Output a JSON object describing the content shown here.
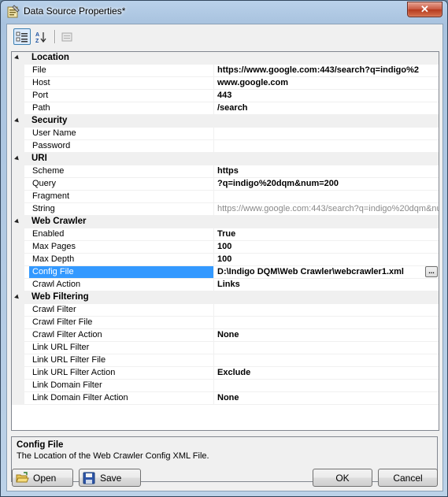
{
  "window": {
    "title": "Data Source Properties*",
    "close_glyph": "✕"
  },
  "toolbar": {
    "categorized_icon": "categorized-icon",
    "alphabetical_icon": "alphabetical-icon",
    "property_pages_icon": "property-pages-icon"
  },
  "grid": {
    "categories": [
      {
        "label": "Location",
        "props": [
          {
            "name": "File",
            "value": "https://www.google.com:443/search?q=indigo%2"
          },
          {
            "name": "Host",
            "value": "www.google.com"
          },
          {
            "name": "Port",
            "value": "443"
          },
          {
            "name": "Path",
            "value": "/search"
          }
        ]
      },
      {
        "label": "Security",
        "props": [
          {
            "name": "User Name",
            "value": ""
          },
          {
            "name": "Password",
            "value": ""
          }
        ]
      },
      {
        "label": "URI",
        "props": [
          {
            "name": "Scheme",
            "value": "https"
          },
          {
            "name": "Query",
            "value": "?q=indigo%20dqm&num=200"
          },
          {
            "name": "Fragment",
            "value": ""
          },
          {
            "name": "String",
            "value": "https://www.google.com:443/search?q=indigo%20dqm&nu"
          }
        ]
      },
      {
        "label": "Web Crawler",
        "props": [
          {
            "name": "Enabled",
            "value": "True"
          },
          {
            "name": "Max Pages",
            "value": "100"
          },
          {
            "name": "Max Depth",
            "value": "100"
          },
          {
            "name": "Config File",
            "value": "D:\\Indigo DQM\\Web Crawler\\webcrawler1.xml",
            "ellipsis": "..."
          },
          {
            "name": "Crawl Action",
            "value": "Links"
          }
        ]
      },
      {
        "label": "Web Filtering",
        "props": [
          {
            "name": "Crawl Filter",
            "value": ""
          },
          {
            "name": "Crawl Filter File",
            "value": ""
          },
          {
            "name": "Crawl Filter Action",
            "value": "None"
          },
          {
            "name": "Link URL Filter",
            "value": ""
          },
          {
            "name": "Link URL Filter File",
            "value": ""
          },
          {
            "name": "Link URL Filter Action",
            "value": "Exclude"
          },
          {
            "name": "Link Domain Filter",
            "value": ""
          },
          {
            "name": "Link Domain Filter Action",
            "value": "None"
          }
        ]
      }
    ]
  },
  "description": {
    "title": "Config File",
    "text": "The Location of the Web Crawler Config XML File."
  },
  "buttons": {
    "open": "Open",
    "save": "Save",
    "ok": "OK",
    "cancel": "Cancel"
  },
  "colors": {
    "selection": "#3399ff",
    "readonly": "#8a8a8a"
  }
}
